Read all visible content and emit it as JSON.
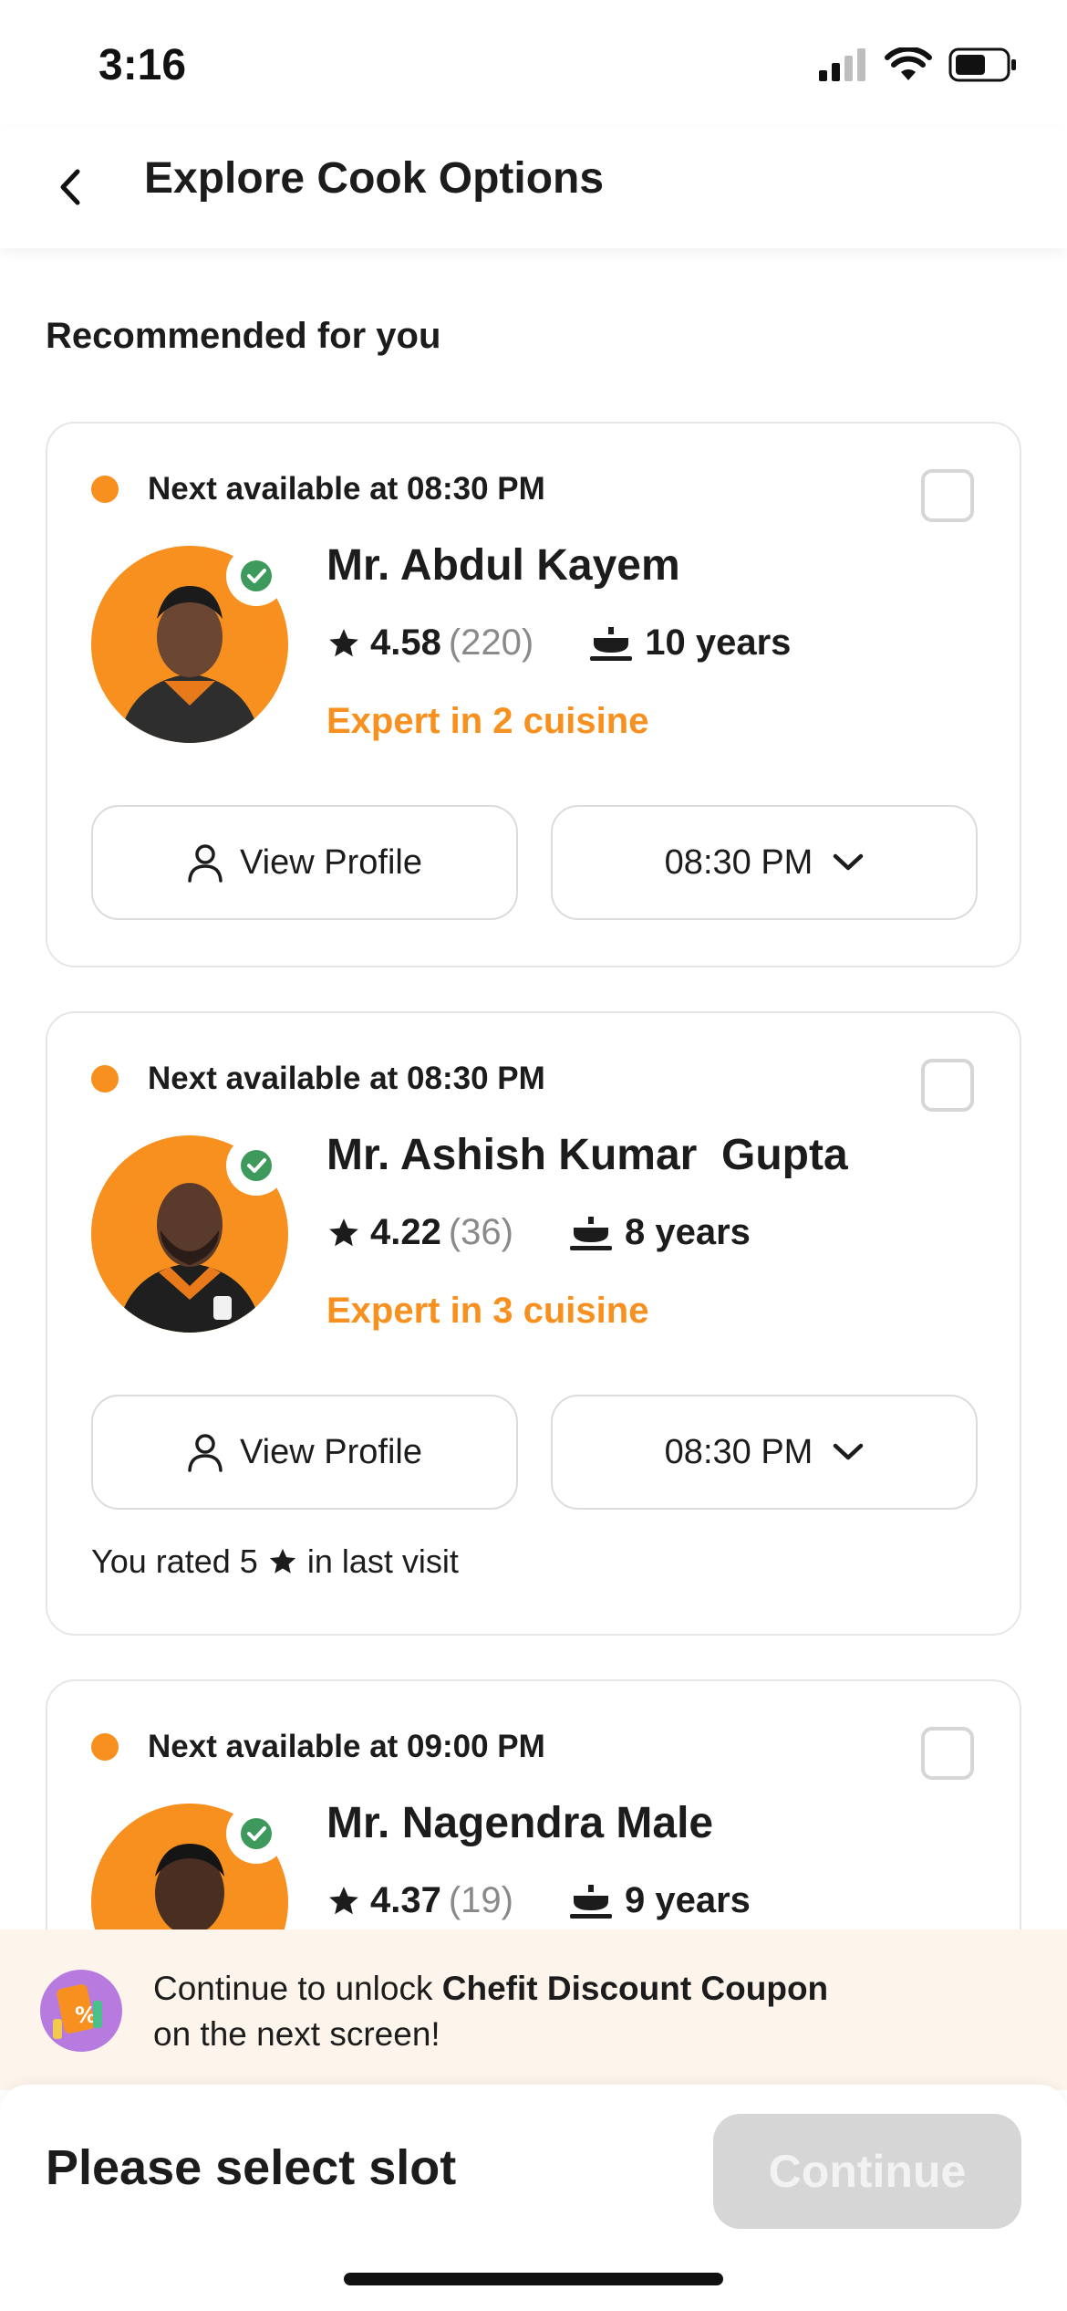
{
  "status_bar": {
    "time": "3:16"
  },
  "header": {
    "title": "Explore Cook Options"
  },
  "section_title": "Recommended for you",
  "cooks": [
    {
      "availability": "Next available at 08:30 PM",
      "name": "Mr. Abdul Kayem",
      "rating": "4.58",
      "rating_count": "(220)",
      "experience": "10 years",
      "expertise": "Expert in 2 cuisine",
      "view_profile_label": "View Profile",
      "slot": "08:30 PM"
    },
    {
      "availability": "Next available at 08:30 PM",
      "name": "Mr. Ashish Kumar  Gupta",
      "rating": "4.22",
      "rating_count": "(36)",
      "experience": "8 years",
      "expertise": "Expert in 3 cuisine",
      "view_profile_label": "View Profile",
      "slot": "08:30 PM",
      "rated_note_prefix": "You rated 5",
      "rated_note_suffix": "in last visit"
    },
    {
      "availability": "Next available at 09:00 PM",
      "name": "Mr. Nagendra Male",
      "rating": "4.37",
      "rating_count": "(19)",
      "experience": "9 years"
    }
  ],
  "coupon": {
    "prefix": "Continue to unlock ",
    "highlight": "Chefit Discount Coupon",
    "suffix": "on the next screen!"
  },
  "bottom_bar": {
    "slot_label": "Please select slot",
    "continue_label": "Continue"
  },
  "colors": {
    "accent": "#f7901e",
    "verified": "#3d9a5c",
    "disabled": "#d6d6d6"
  }
}
